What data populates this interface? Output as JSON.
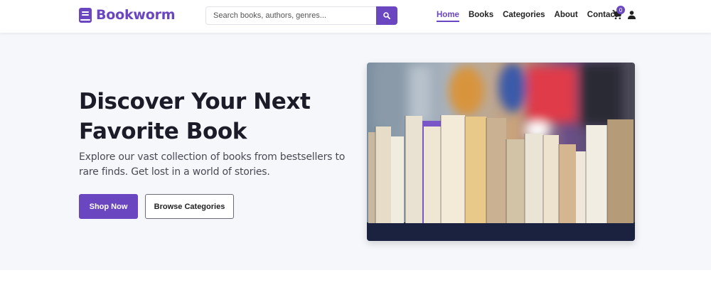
{
  "brand": {
    "name": "Bookworm",
    "color": "#6b46c1",
    "icon": "book-icon"
  },
  "search": {
    "placeholder": "Search books, authors, genres...",
    "icon": "search-icon"
  },
  "nav": {
    "items": [
      {
        "label": "Home",
        "active": true
      },
      {
        "label": "Books",
        "active": false
      },
      {
        "label": "Categories",
        "active": false
      },
      {
        "label": "About",
        "active": false
      },
      {
        "label": "Contact",
        "active": false
      }
    ]
  },
  "cart": {
    "count": "0",
    "icon": "cart-icon"
  },
  "user": {
    "icon": "user-icon"
  },
  "hero": {
    "title": "Discover Your Next Favorite Book",
    "subtitle": "Explore our vast collection of books from bestsellers to rare finds. Get lost in a world of stories.",
    "primary_button": "Shop Now",
    "secondary_button": "Browse Categories",
    "image": "books-on-shelf-photo"
  }
}
